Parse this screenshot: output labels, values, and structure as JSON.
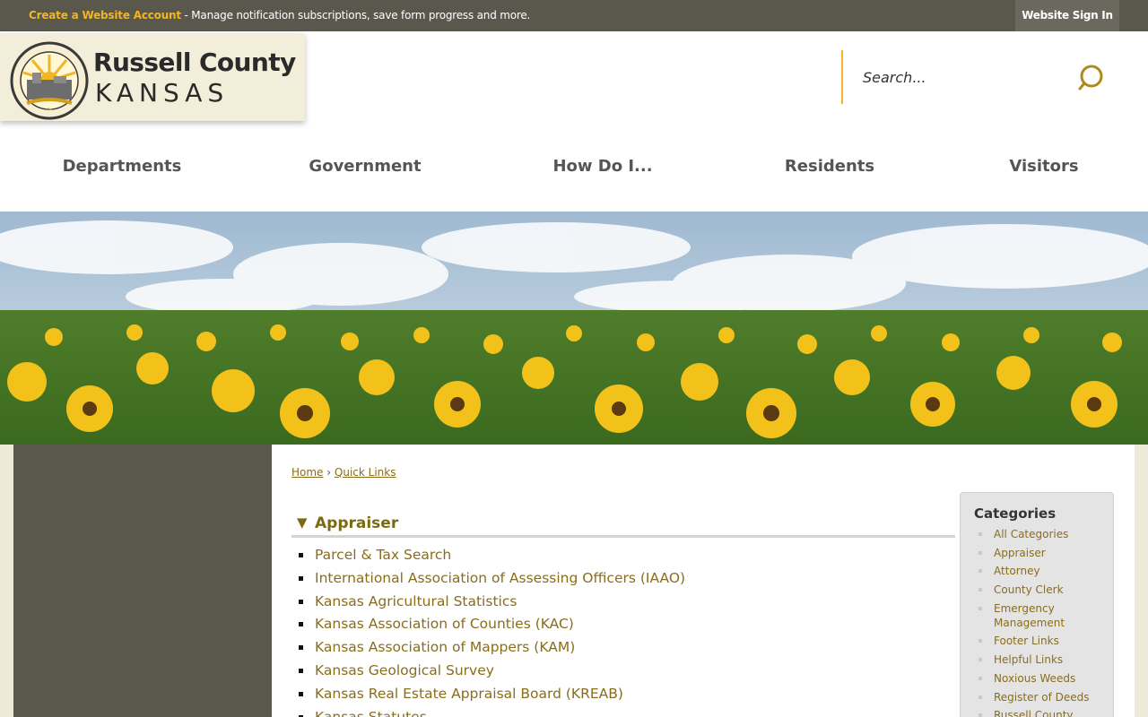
{
  "topbar": {
    "create_account_label": "Create a Website Account",
    "create_account_suffix": " - Manage notification subscriptions, save form progress and more.",
    "signin_label": "Website Sign In"
  },
  "logo": {
    "name": "Russell County",
    "state": "KANSAS"
  },
  "search": {
    "placeholder": "Search..."
  },
  "nav": {
    "items": [
      "Departments",
      "Government",
      "How Do I...",
      "Residents",
      "Visitors"
    ]
  },
  "breadcrumb": {
    "home": "Home",
    "separator": "›",
    "current": "Quick Links"
  },
  "section": {
    "arrow": "▼",
    "title": "Appraiser",
    "links": [
      "Parcel & Tax Search",
      "International Association of Assessing Officers (IAAO)",
      "Kansas Agricultural Statistics",
      "Kansas Association of Counties (KAC)",
      "Kansas Association of Mappers (KAM)",
      "Kansas Geological Survey",
      "Kansas Real Estate Appraisal Board (KREAB)",
      "Kansas Statutes"
    ]
  },
  "categories": {
    "title": "Categories",
    "items": [
      "All Categories",
      "Appraiser",
      "Attorney",
      "County Clerk",
      "Emergency Management",
      "Footer Links",
      "Helpful Links",
      "Noxious Weeds",
      "Register of Deeds",
      "Russell County"
    ]
  },
  "colors": {
    "topbar": "#5a574c",
    "accent": "#f0b623",
    "link": "#8a6d1b",
    "heading": "#7b6a14"
  }
}
